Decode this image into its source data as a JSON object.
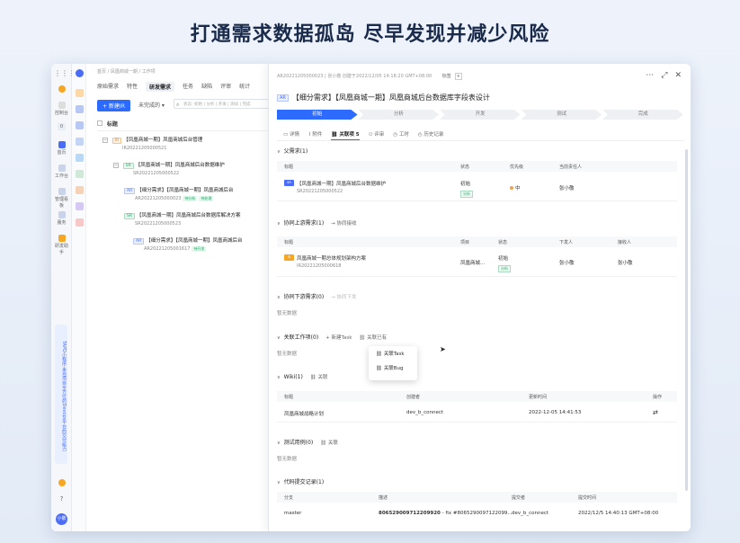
{
  "hero": {
    "title": "打通需求数据孤岛 尽早发现并减少风险"
  },
  "rail": {
    "items": [
      {
        "label": "控制台"
      },
      {
        "label": "首页"
      },
      {
        "label": "工作台"
      },
      {
        "label": "管理看板"
      },
      {
        "label": "服务"
      },
      {
        "label": "研发助手"
      }
    ],
    "promo": "TAPD小程序·来自项目全方位的Devops平台的交付能力",
    "badge_count": "0",
    "avatar": "小敬"
  },
  "list": {
    "breadcrumb": "首页 / 凤凰商城一期 / 工作项",
    "tabs": [
      "原始需求",
      "特性",
      "研发需求",
      "任务",
      "缺陷",
      "评审",
      "统计"
    ],
    "new_button": "+ 新建IR",
    "filter": "未完成的 ▾",
    "search_placeholder": "状态: 初始 | 分析 | 开发 | 测试 | 完成",
    "header_title": "标题",
    "rows": [
      {
        "tag": "IR",
        "title": "【凤凰商城一期】凤凰商城后台管理",
        "id": "IR20221205000521"
      },
      {
        "tag": "SR",
        "title": "【凤凰商城一期】凤凰商城后台数据维护",
        "id": "SR20221205000522"
      },
      {
        "tag": "AR",
        "title": "【细分需求】【凤凰商城一期】凤凰商城后台",
        "id": "AR20221205000023",
        "pills": [
          "待分析",
          "待处理"
        ]
      },
      {
        "tag": "SR",
        "title": "【凤凰商城一期】凤凰商城后台数据库解决方案",
        "id": "SR20221205000523"
      },
      {
        "tag": "AR",
        "title": "【细分需求】【凤凰商城一期】凤凰商城后台",
        "id": "AR20221205001617",
        "pills": [
          "待开发"
        ]
      }
    ]
  },
  "detail": {
    "id_line": "AR20221205000023",
    "creator_line": "张小敬 创建于2022/12/05 14:18:20 GMT+08:00",
    "tag_label": "标签",
    "title_tag": "AR",
    "title": "【细分需求】【凤凰商城一期】凤凰商城后台数据库字段表设计",
    "flow": [
      "初始",
      "分析",
      "开发",
      "测试",
      "完成"
    ],
    "tabs": [
      "详情",
      "附件",
      "关联项 5",
      "评审",
      "工时",
      "历史记录"
    ],
    "parent": {
      "section": "父需求(1)",
      "headers": [
        "标题",
        "状态",
        "优先级",
        "当前责任人"
      ],
      "row": {
        "tag": "SR",
        "title": "【凤凰商城一期】凤凰商城后台数据维护",
        "id": "SR20221205000522",
        "status": "初始",
        "status_badge": "分析",
        "priority": "中",
        "owner": "张小敬"
      }
    },
    "upstream": {
      "section": "协同上游需求(1)",
      "action": "→ 协同接收",
      "headers": [
        "标题",
        "项目",
        "状态",
        "下发人",
        "接收人"
      ],
      "row": {
        "tag": "IR",
        "title": "凤凰商城一期总体规划架构方案",
        "id": "IR20221205000618",
        "project": "凤凰商城...",
        "status": "初始",
        "status_badge": "分析",
        "sender": "张小敬",
        "receiver": "张小敬"
      }
    },
    "downstream": {
      "section": "协同下游需求(0)",
      "action": "→ 协同下发",
      "empty": "暂无数据"
    },
    "workitems": {
      "section": "关联工作项(0)",
      "actions": [
        "+ 新建Task",
        "关联已有"
      ],
      "empty": "暂无数据",
      "dropdown": [
        "关联Task",
        "关联Bug"
      ]
    },
    "wiki": {
      "section": "Wiki(1)",
      "action": "关联",
      "headers": [
        "标题",
        "创建者",
        "更新时间",
        "操作"
      ],
      "row": {
        "title": "凤凰商城战略计划",
        "creator": "dev_b_connect",
        "updated": "2022-12-05 14:41:53"
      }
    },
    "testcases": {
      "section": "测试用例(0)",
      "action": "关联",
      "empty": "暂无数据"
    },
    "commits": {
      "section": "代码提交记录(1)",
      "headers": [
        "分支",
        "描述",
        "提交者",
        "提交时间"
      ],
      "row": {
        "branch": "master",
        "desc_bold": "806529009712209920",
        "desc": " - fix #8065290097122099...",
        "author": "dev_b_connect",
        "time": "2022/12/5 14:40:13 GMT+08:00"
      }
    }
  }
}
